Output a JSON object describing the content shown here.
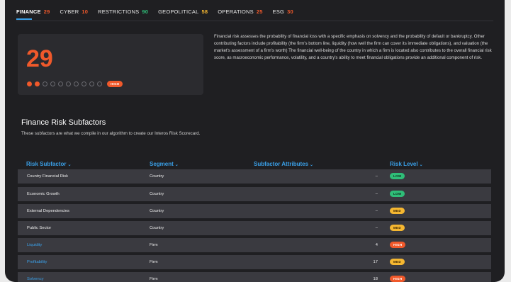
{
  "tabs": [
    {
      "label": "FINANCE",
      "score": "29",
      "color": "#f0592b",
      "active": true
    },
    {
      "label": "CYBER",
      "score": "10",
      "color": "#f0592b"
    },
    {
      "label": "RESTRICTIONS",
      "score": "90",
      "color": "#2fbd78"
    },
    {
      "label": "GEOPOLITICAL",
      "score": "58",
      "color": "#f5b731"
    },
    {
      "label": "OPERATIONS",
      "score": "25",
      "color": "#f0592b"
    },
    {
      "label": "ESG",
      "score": "30",
      "color": "#f0592b"
    }
  ],
  "score_card": {
    "score": "29",
    "level": "HIGH",
    "filled_dots": 2,
    "total_dots": 10,
    "accent": "#f0592b"
  },
  "description": "Financial risk assesses the probability of financial loss with a specific emphasis on solvency and the probability of default or bankruptcy. Other contributing factors include profitability (the firm's bottom line, liquidity (how well the firm can cover its immediate obligations), and valuation (the market's assessment of a firm's worth) The financial well-being of the country in which a firm is located also contributes to the overall financial risk score, as macroeconomic performance, volatility, and a country's ability to meet financial obligations provide an additional component of risk.",
  "subfactors": {
    "title": "Finance Risk Subfactors",
    "subtitle": "These subfactors are what we compile in our algorithm to create our Interos Risk Scorecard.",
    "columns": {
      "subfactor": "Risk Subfactor",
      "segment": "Segment",
      "attributes": "Subfactor Attributes",
      "level": "Risk Level"
    },
    "rows": [
      {
        "name": "Country Financial Risk",
        "segment": "Country",
        "attributes": "–",
        "level": "LOW",
        "link": false
      },
      {
        "name": "Economic Growth",
        "segment": "Country",
        "attributes": "–",
        "level": "LOW",
        "link": false
      },
      {
        "name": "External Dependencies",
        "segment": "Country",
        "attributes": "–",
        "level": "MED",
        "link": false
      },
      {
        "name": "Public Sector",
        "segment": "Country",
        "attributes": "–",
        "level": "MED",
        "link": false
      },
      {
        "name": "Liquidity",
        "segment": "Firm",
        "attributes": "4",
        "level": "HIGH",
        "link": true
      },
      {
        "name": "Profitability",
        "segment": "Firm",
        "attributes": "17",
        "level": "MED",
        "link": true
      },
      {
        "name": "Solvency",
        "segment": "Firm",
        "attributes": "18",
        "level": "HIGH",
        "link": true
      }
    ]
  },
  "icons": {
    "sort": "chevron-down-icon"
  }
}
